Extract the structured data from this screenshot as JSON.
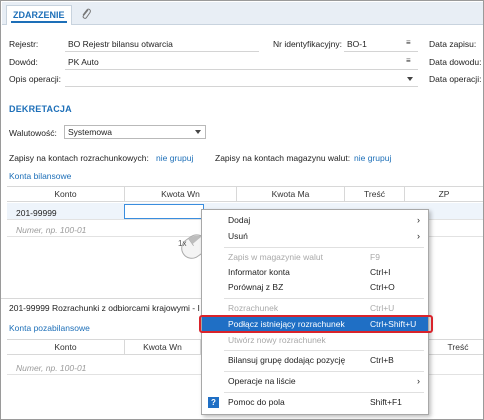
{
  "tabs": {
    "active": "ZDARZENIE",
    "attachment_icon": "paperclip-icon"
  },
  "header": {
    "rejestr_label": "Rejestr:",
    "rejestr_value": "BO Rejestr bilansu otwarcia",
    "nr_label": "Nr identyfikacyjny:",
    "nr_value": "BO-1",
    "data_zapisu_label": "Data zapisu:",
    "dowod_label": "Dowód:",
    "dowod_value": "PK Auto",
    "data_dowodu_label": "Data dowodu:",
    "opis_label": "Opis operacji:",
    "data_operacji_label": "Data operacji:"
  },
  "dekretacja": {
    "title": "DEKRETACJA",
    "walutowosc_label": "Walutowość:",
    "walutowosc_value": "Systemowa",
    "zapisy_rozr_label": "Zapisy na kontach rozrachunkowych:",
    "zapisy_rozr_link": "nie grupuj",
    "zapisy_mag_label": "Zapisy na kontach magazynu walut:",
    "zapisy_mag_link": "nie grupuj"
  },
  "konta_bilansowe": {
    "title": "Konta bilansowe",
    "columns": [
      "Konto",
      "Kwota Wn",
      "Kwota Ma",
      "Treść",
      "ZP"
    ],
    "row1_konto": "201-99999",
    "new_row_placeholder": "Numer, np. 100-01"
  },
  "rozrachunki_row": "201-99999  Rozrachunki z odbiorcami krajowymi - I",
  "konta_pozabilansowe": {
    "title": "Konta pozabilansowe",
    "columns": [
      "Konto",
      "Kwota Wn",
      "Treść"
    ],
    "new_row_placeholder": "Numer, np. 100-01"
  },
  "mouse_hint": "1x",
  "context_menu": {
    "items": [
      {
        "label": "Dodaj",
        "shortcut": "",
        "submenu": true,
        "disabled": false
      },
      {
        "label": "Usuń",
        "shortcut": "",
        "submenu": true,
        "disabled": false
      },
      {
        "label": "Zapis w magazynie walut",
        "shortcut": "F9",
        "submenu": false,
        "disabled": true
      },
      {
        "label": "Informator konta",
        "shortcut": "Ctrl+I",
        "submenu": false,
        "disabled": false
      },
      {
        "label": "Porównaj z BZ",
        "shortcut": "Ctrl+O",
        "submenu": false,
        "disabled": false
      },
      {
        "label": "Rozrachunek",
        "shortcut": "Ctrl+U",
        "submenu": false,
        "disabled": true
      },
      {
        "label": "Podłącz istniejący rozrachunek",
        "shortcut": "Ctrl+Shift+U",
        "submenu": false,
        "disabled": false,
        "highlighted": true
      },
      {
        "label": "Utwórz nowy rozrachunek",
        "shortcut": "",
        "submenu": false,
        "disabled": true
      },
      {
        "label": "Bilansuj grupę dodając pozycję",
        "shortcut": "Ctrl+B",
        "submenu": false,
        "disabled": false
      },
      {
        "label": "Operacje na liście",
        "shortcut": "",
        "submenu": true,
        "disabled": false
      },
      {
        "label": "Pomoc do pola",
        "shortcut": "Shift+F1",
        "submenu": false,
        "disabled": false,
        "icon": "help-icon"
      }
    ]
  },
  "colors": {
    "accent": "#1d6fb8",
    "highlight": "#1f6fc5",
    "ring": "#d9232b"
  }
}
